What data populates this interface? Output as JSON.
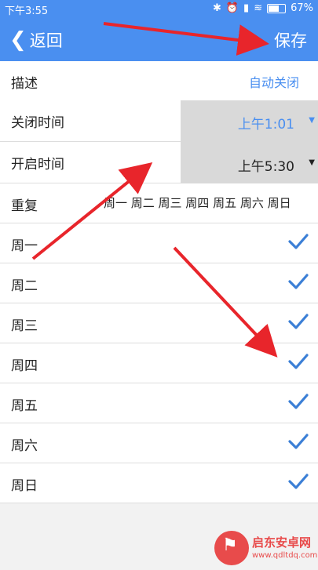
{
  "status_bar": {
    "time": "下午3:55",
    "battery": "67%"
  },
  "header": {
    "back_label": "返回",
    "save_label": "保存"
  },
  "rows": {
    "description": {
      "label": "描述",
      "value": "自动关闭"
    },
    "close_time": {
      "label": "关闭时间",
      "value": "上午1:01"
    },
    "open_time": {
      "label": "开启时间",
      "value": "上午5:30"
    },
    "repeat": {
      "label": "重复",
      "value": "周一 周二 周三 周四 周五 周六 周日"
    }
  },
  "weekdays": [
    "周一",
    "周二",
    "周三",
    "周四",
    "周五",
    "周六",
    "周日"
  ],
  "watermark": {
    "text": "启东安卓网",
    "url": "www.qdltdq.com"
  },
  "colors": {
    "accent": "#4a8ff0",
    "annotation_arrow": "#e8252b"
  }
}
